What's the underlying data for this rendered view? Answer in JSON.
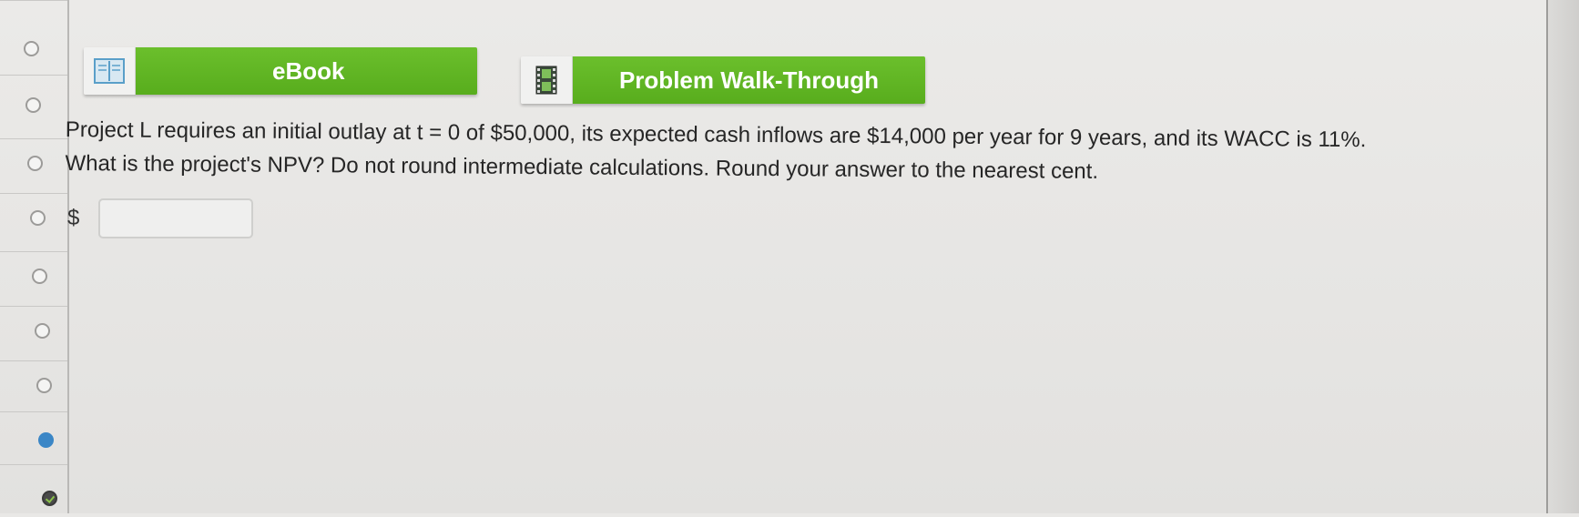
{
  "toolbar": {
    "ebook_label": "eBook",
    "ebook_icon": "book-icon",
    "walkthrough_label": "Problem Walk-Through",
    "walkthrough_icon": "film-icon",
    "accent_color": "#5fb524"
  },
  "question": {
    "line1": "Project L requires an initial outlay at t = 0 of $50,000, its expected cash inflows are $14,000 per year for 9 years, and its WACC is 11%.",
    "line2": "What is the project's NPV? Do not round intermediate calculations. Round your answer to the nearest cent."
  },
  "answer": {
    "currency_symbol": "$",
    "value": "",
    "placeholder": ""
  },
  "nav": {
    "items": [
      {
        "state": "unanswered"
      },
      {
        "state": "unanswered"
      },
      {
        "state": "unanswered"
      },
      {
        "state": "unanswered"
      },
      {
        "state": "unanswered"
      },
      {
        "state": "unanswered"
      },
      {
        "state": "unanswered"
      },
      {
        "state": "current"
      },
      {
        "state": "completed"
      }
    ],
    "current_color": "#3b86c6"
  }
}
